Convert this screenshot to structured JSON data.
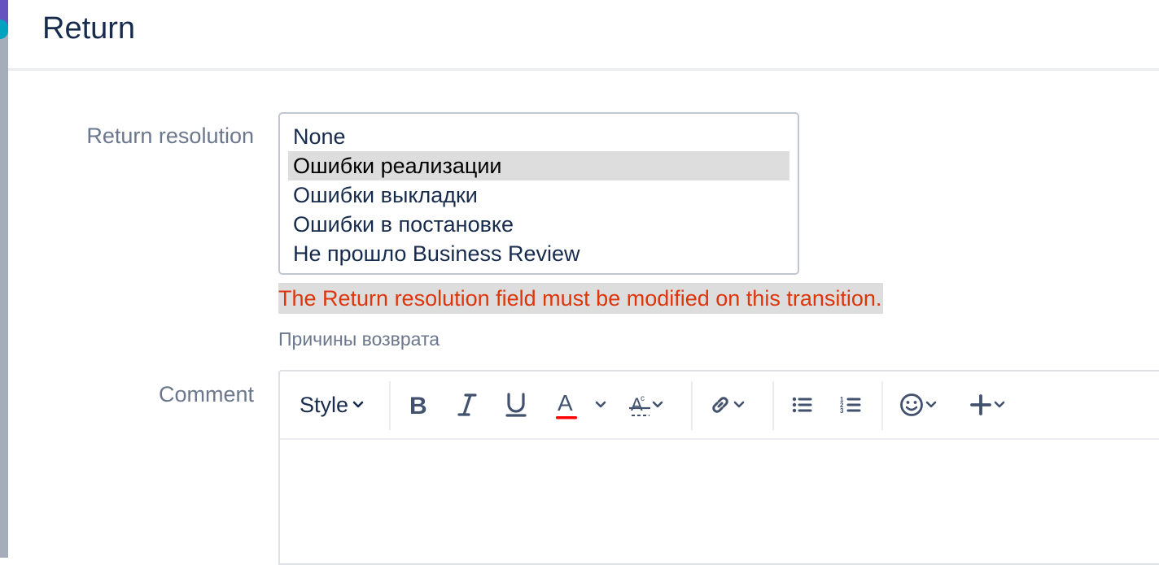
{
  "dialog": {
    "title": "Return"
  },
  "return_resolution": {
    "label": "Return resolution",
    "options": [
      "None",
      "Ошибки реализации",
      "Ошибки выкладки",
      "Ошибки в постановке",
      "Не прошло Business Review"
    ],
    "selected": "Ошибки реализации",
    "error": "The Return resolution field must be modified on this transition.",
    "description": "Причины возврата"
  },
  "comment": {
    "label": "Comment",
    "toolbar": {
      "style_label": "Style",
      "icons": [
        "bold-icon",
        "italic-icon",
        "underline-icon",
        "text-color-icon",
        "clear-formatting-icon",
        "link-icon",
        "bullet-list-icon",
        "numbered-list-icon",
        "emoji-icon",
        "insert-icon"
      ]
    },
    "text_color_accent": "#ff0000"
  },
  "colors": {
    "error": "#de350b",
    "label": "#6b778c",
    "text": "#172b4d"
  }
}
